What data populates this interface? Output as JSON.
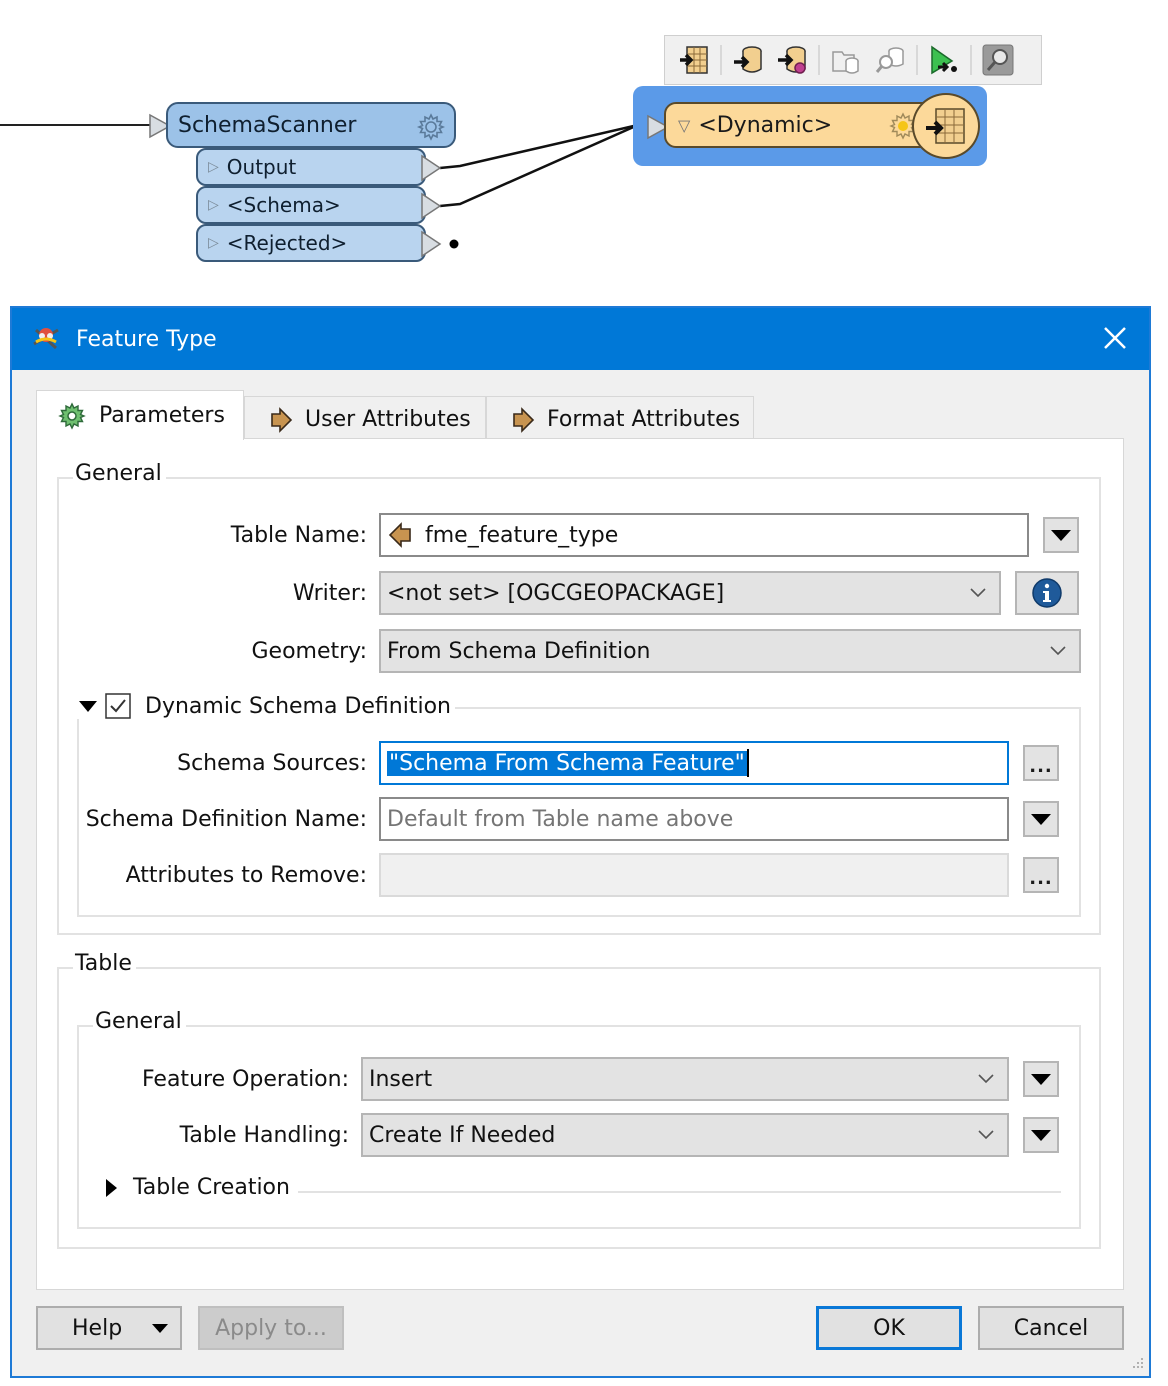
{
  "canvas": {
    "schema_scanner": {
      "title": "SchemaScanner",
      "ports": [
        "Output",
        "<Schema>",
        "<Rejected>"
      ]
    },
    "dynamic_writer": {
      "title": "<Dynamic>"
    },
    "toolbar_icons": [
      "feature-type-writer-icon",
      "add-writer-icon",
      "writer-settings-icon",
      "open-containing-folder-icon",
      "inspect-dataset-icon",
      "run-to-this-icon",
      "zoom-icon"
    ],
    "colors": {
      "scanner_fill": "#9cc2e8",
      "writer_fill": "#fcd99a",
      "selection": "#5b9ae8"
    }
  },
  "dialog": {
    "title": "Feature Type",
    "close_icon": "close-icon",
    "tabs": [
      {
        "label": "Parameters",
        "icon": "gear-icon",
        "active": true
      },
      {
        "label": "User Attributes",
        "icon": "attribute-arrow-icon",
        "active": false
      },
      {
        "label": "Format Attributes",
        "icon": "attribute-arrow-icon",
        "active": false
      }
    ],
    "general": {
      "legend": "General",
      "table_name_label": "Table Name:",
      "table_name_value": "fme_feature_type",
      "writer_label": "Writer:",
      "writer_value": "<not set> [OGCGEOPACKAGE]",
      "geometry_label": "Geometry:",
      "geometry_value": "From Schema Definition",
      "dynamic": {
        "legend": "Dynamic Schema Definition",
        "checked": true,
        "schema_sources_label": "Schema Sources:",
        "schema_sources_value": "\"Schema From Schema Feature\"",
        "schema_def_name_label": "Schema Definition Name:",
        "schema_def_name_placeholder": "Default from Table name above",
        "attributes_remove_label": "Attributes to Remove:",
        "attributes_remove_value": ""
      }
    },
    "table": {
      "legend": "Table",
      "general_legend": "General",
      "feature_operation_label": "Feature Operation:",
      "feature_operation_value": "Insert",
      "table_handling_label": "Table Handling:",
      "table_handling_value": "Create If Needed",
      "table_creation_legend": "Table Creation"
    },
    "buttons": {
      "help": "Help",
      "apply_to": "Apply to...",
      "ok": "OK",
      "cancel": "Cancel"
    },
    "colors": {
      "titlebar": "#0078d7",
      "selection": "#0078d7"
    }
  }
}
